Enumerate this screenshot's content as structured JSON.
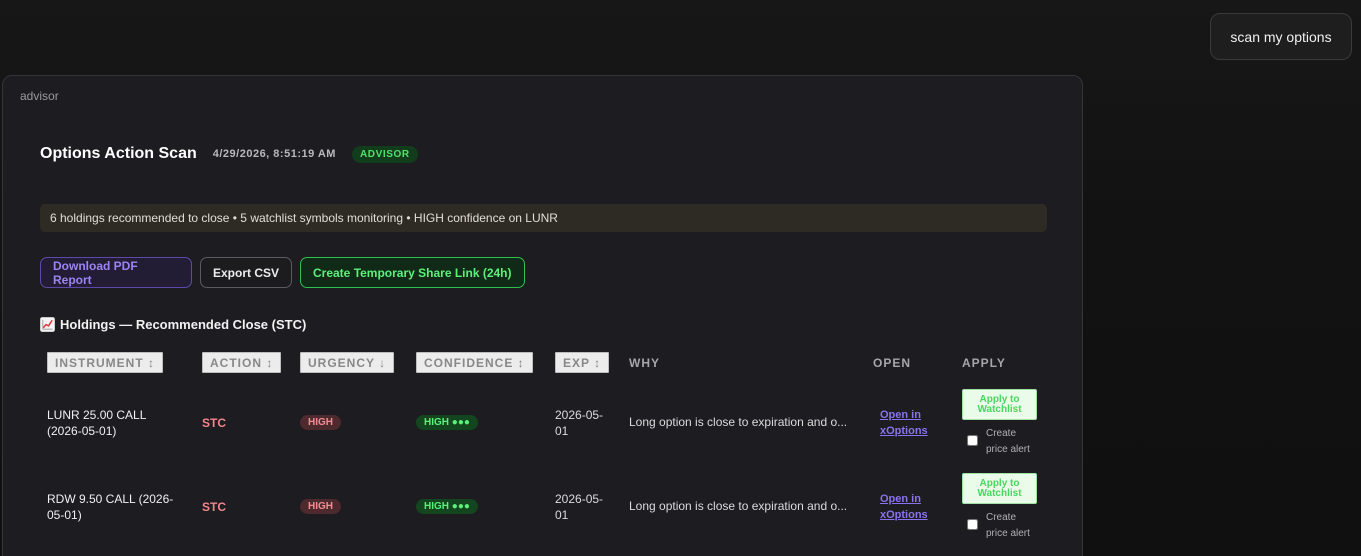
{
  "user_message": "scan my options",
  "card": {
    "role": "advisor",
    "title": "Options Action Scan",
    "timestamp": "4/29/2026, 8:51:19 AM",
    "badge": "ADVISOR",
    "summary": "6 holdings recommended to close • 5 watchlist symbols monitoring • HIGH confidence on LUNR",
    "buttons": {
      "pdf": "Download PDF Report",
      "csv": "Export CSV",
      "share": "Create Temporary Share Link (24h)"
    },
    "section_title": "Holdings — Recommended Close (STC)",
    "table": {
      "headers": {
        "instrument": "INSTRUMENT ↕",
        "action": "ACTION ↕",
        "urgency": "URGENCY ↓",
        "confidence": "CONFIDENCE ↕",
        "exp": "EXP ↕",
        "why": "WHY",
        "open": "OPEN",
        "apply": "APPLY"
      },
      "rows": [
        {
          "instrument_l1": "LUNR 25.00 CALL",
          "instrument_l2": "(2026-05-01)",
          "action": "STC",
          "urgency": "HIGH",
          "confidence": "HIGH ●●●",
          "exp_l1": "2026-05-",
          "exp_l2": "01",
          "why": "Long option is close to expiration and o...",
          "open_l1": "Open in",
          "open_l2": "xOptions",
          "apply_l1": "Apply to",
          "apply_l2": "Watchlist",
          "alert_l1": "Create",
          "alert_l2": "price alert"
        },
        {
          "instrument_l1": "RDW 9.50 CALL (2026-",
          "instrument_l2": "05-01)",
          "action": "STC",
          "urgency": "HIGH",
          "confidence": "HIGH ●●●",
          "exp_l1": "2026-05-",
          "exp_l2": "01",
          "why": "Long option is close to expiration and o...",
          "open_l1": "Open in",
          "open_l2": "xOptions",
          "apply_l1": "Apply to",
          "apply_l2": "Watchlist",
          "alert_l1": "Create",
          "alert_l2": "price alert"
        }
      ]
    }
  },
  "colors": {
    "background": "#121212",
    "card": "#1c1c21",
    "stc": "#f2868b",
    "advisor_green": "#4fe36b",
    "link_purple": "#8a73ee"
  },
  "icons": {
    "section": "chart-increasing-icon"
  }
}
